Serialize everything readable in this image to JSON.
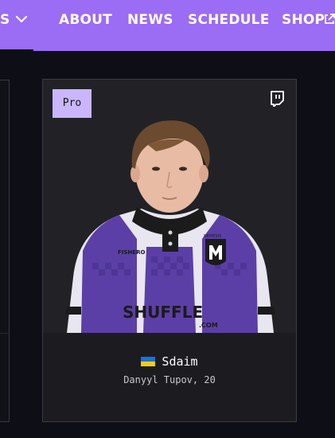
{
  "nav": {
    "partial_label": "S",
    "items": [
      {
        "label": "ABOUT"
      },
      {
        "label": "NEWS"
      },
      {
        "label": "SCHEDULE"
      },
      {
        "label": "SHOP"
      }
    ],
    "bg_color": "#9b6cf4"
  },
  "player_card": {
    "badge": "Pro",
    "social_icon": "twitch-icon",
    "nickname": "Sdaim",
    "country_flag": "ukraine-flag-icon",
    "subtitle": "Danyyl Tupov, 20",
    "jersey": {
      "sponsor_text": "SHUFFLE",
      "sponsor_domain": ".COM",
      "secondary_sponsor": "FISHERO",
      "team_crest_text": "NEMESIS"
    },
    "accent_color": "#c9b6ff"
  }
}
